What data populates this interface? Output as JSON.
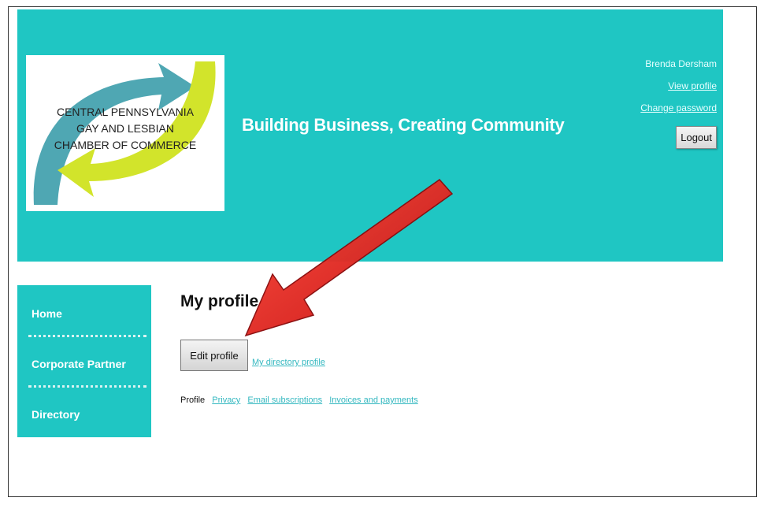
{
  "brand": {
    "logo_text": "CENTRAL PENNSYLVANIA\nGAY AND LESBIAN\nCHAMBER OF COMMERCE",
    "tagline": "Building Business, Creating Community"
  },
  "user": {
    "name": "Brenda Dersham",
    "view_profile": "View profile",
    "change_password": "Change password",
    "logout": "Logout"
  },
  "sidebar": {
    "items": [
      {
        "label": "Home"
      },
      {
        "label": "Corporate Partner"
      },
      {
        "label": "Directory"
      }
    ]
  },
  "main": {
    "title": "My profile",
    "edit_button": "Edit profile",
    "directory_link": "My directory profile",
    "tabs": {
      "current": "Profile",
      "links": [
        "Privacy",
        "Email subscriptions",
        "Invoices and payments"
      ]
    }
  },
  "colors": {
    "header_bg": "#1fc6c3",
    "link": "#34b8c0",
    "annotation_arrow": "#e0161b"
  }
}
